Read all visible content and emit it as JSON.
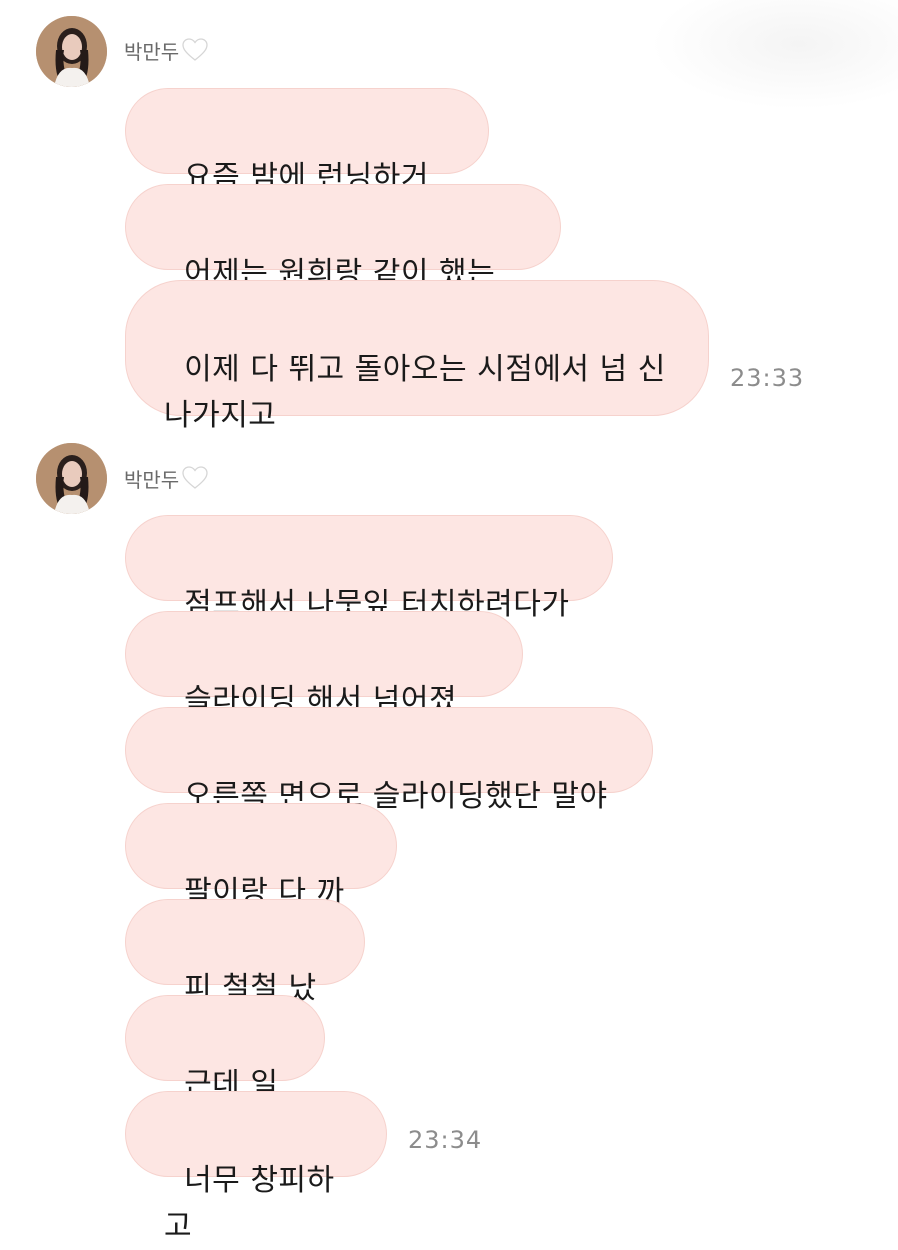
{
  "groups": [
    {
      "sender": "박만두",
      "messages": [
        "요즘 밤에 런닝하거든",
        "어제는 원희랑 같이 했는데",
        "이제 다 뛰고 돌아오는 시점에서 넘 신\n나가지고"
      ],
      "time": "23:33"
    },
    {
      "sender": "박만두",
      "messages": [
        "점프해서 나뭇잎 터치하려다가",
        "슬라이딩 해서 넘어졌는데",
        "오른쪽 면으로 슬라이딩했단 말야",
        "팔이랑 다 까짐",
        "피 철철 났어",
        "근데 일단",
        "너무 창피하고"
      ],
      "time": "23:34"
    }
  ],
  "icons": {
    "heart": "white-heart-icon",
    "avatar": "profile-photo"
  },
  "colors": {
    "bubble_bg": "#fde6e3",
    "bubble_border": "#f6d2cd",
    "time_text": "#8c8c8c",
    "sender_text": "#6a6a6a"
  }
}
